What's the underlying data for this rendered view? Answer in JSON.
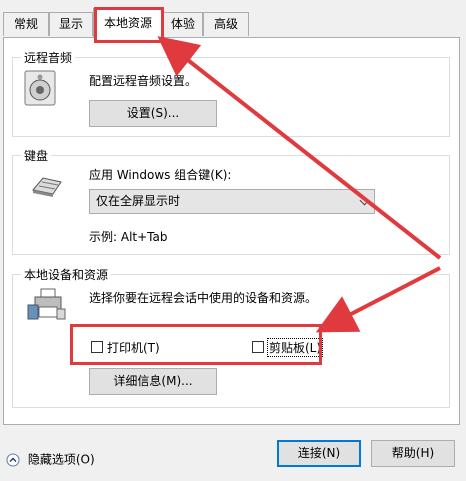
{
  "tabs": [
    {
      "label": "常规"
    },
    {
      "label": "显示"
    },
    {
      "label": "本地资源"
    },
    {
      "label": "体验"
    },
    {
      "label": "高级"
    }
  ],
  "remote_audio": {
    "title": "远程音频",
    "description": "配置远程音频设置。",
    "settings_button": "设置(S)..."
  },
  "keyboard": {
    "title": "键盘",
    "label": "应用 Windows 组合键(K):",
    "selected": "仅在全屏显示时",
    "example": "示例: Alt+Tab"
  },
  "local_devices": {
    "title": "本地设备和资源",
    "description": "选择你要在远程会话中使用的设备和资源。",
    "printer_label": "打印机(T)",
    "clipboard_label": "剪贴板(L)",
    "details_button": "详细信息(M)..."
  },
  "footer": {
    "hide_options": "隐藏选项(O)",
    "connect_button": "连接(N)",
    "help_button": "帮助(H)"
  },
  "colors": {
    "annotation_red": "#e0393e",
    "accent_blue": "#0078d7"
  }
}
